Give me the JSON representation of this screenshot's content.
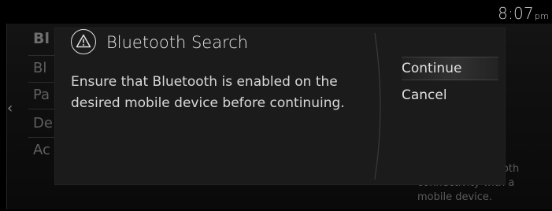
{
  "status_bar": {
    "time": "8:07",
    "ampm": "pm"
  },
  "background_menu": {
    "heading": "Bl",
    "items": [
      "Bl",
      "Pa",
      "De",
      "Ac"
    ],
    "back_icon": "chevron-left-icon",
    "description_line1": "ooth",
    "description_line2": "connectivity with a",
    "description_line3": "mobile device."
  },
  "dialog": {
    "icon": "warning-icon",
    "title": "Bluetooth Search",
    "message": "Ensure that Bluetooth is enabled on the desired mobile device before continuing.",
    "actions": {
      "continue_label": "Continue",
      "cancel_label": "Cancel"
    }
  },
  "colors": {
    "background": "#000000",
    "dialog_background": "#1b1b1b",
    "text_primary": "#e0e0e0",
    "text_dimmed": "#5f5f5f"
  }
}
